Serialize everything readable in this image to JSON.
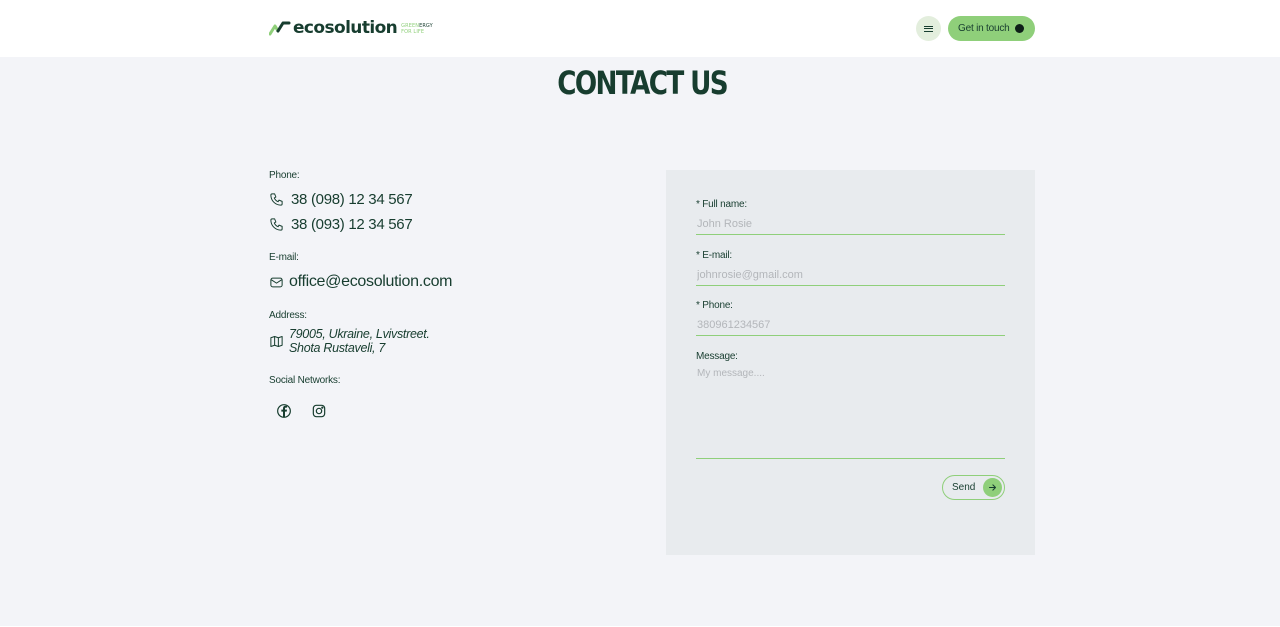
{
  "header": {
    "logo": {
      "name": "ecosolution",
      "tagline_line1_green": "GREEN",
      "tagline_line1_dark": "ERGY",
      "tagline_line2": "FOR LIFE"
    },
    "menu_icon": "menu-icon",
    "cta_label": "Get in touch"
  },
  "page": {
    "title": "CONTACT US"
  },
  "contacts": {
    "phone_label": "Phone:",
    "phones": [
      "38 (098) 12 34 567",
      "38 (093) 12 34 567"
    ],
    "email_label": "E-mail:",
    "email": "office@ecosolution.com",
    "address_label": "Address:",
    "address_line1": "79005, Ukraine, Lvivstreet.",
    "address_line2": "Shota Rustaveli, 7",
    "social_label": "Social Networks:",
    "social_icons": [
      "facebook-icon",
      "instagram-icon"
    ]
  },
  "form": {
    "fullname_label": "* Full name:",
    "fullname_placeholder": "John Rosie",
    "email_label": "* E-mail:",
    "email_placeholder": "johnrosie@gmail.com",
    "phone_label": "* Phone:",
    "phone_placeholder": "380961234567",
    "message_label": "Message:",
    "message_placeholder": "My message....",
    "send_label": "Send"
  },
  "colors": {
    "accent": "#8fcf7a",
    "dark": "#173d2f",
    "background": "#f3f4f8",
    "panel": "#e8ebee"
  }
}
